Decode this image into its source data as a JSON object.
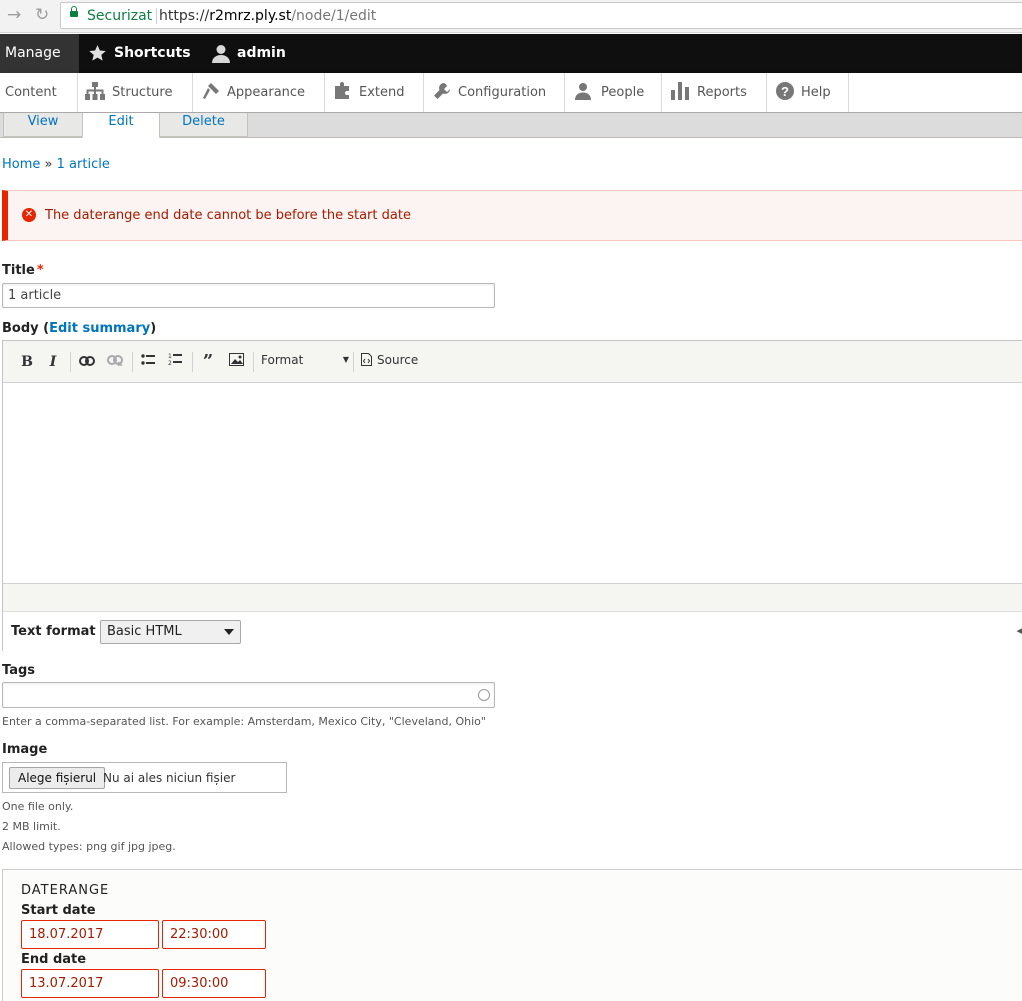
{
  "browser": {
    "secure_label": "Securizat",
    "url_scheme": "https://",
    "url_host": "r2mrz.ply.st",
    "url_path": "/node/1/edit"
  },
  "toolbar": {
    "manage": "Manage",
    "shortcuts": "Shortcuts",
    "user": "admin"
  },
  "tray": {
    "items": [
      "Content",
      "Structure",
      "Appearance",
      "Extend",
      "Configuration",
      "People",
      "Reports",
      "Help"
    ]
  },
  "tabs": [
    "View",
    "Edit",
    "Delete"
  ],
  "breadcrumb": {
    "home": "Home",
    "sep": "»",
    "current": "1 article"
  },
  "error_message": "The daterange end date cannot be before the start date",
  "title_field": {
    "label": "Title",
    "required_mark": "*",
    "value": "1 article"
  },
  "body_field": {
    "label_prefix": "Body (",
    "edit_summary": "Edit summary",
    "label_suffix": ")",
    "format_dropdown": "Format",
    "source_label": "Source",
    "text_format_label": "Text format",
    "text_format_value": "Basic HTML"
  },
  "tags_field": {
    "label": "Tags",
    "value": "",
    "description": "Enter a comma-separated list. For example: Amsterdam, Mexico City, \"Cleveland, Ohio\""
  },
  "image_field": {
    "label": "Image",
    "button": "Alege fișierul",
    "status": "Nu ai ales niciun fișier",
    "help": [
      "One file only.",
      "2 MB limit.",
      "Allowed types: png gif jpg jpeg."
    ]
  },
  "daterange": {
    "legend": "DATERANGE",
    "start_label": "Start date",
    "start_date": "18.07.2017",
    "start_time": "22:30:00",
    "end_label": "End date",
    "end_date": "13.07.2017",
    "end_time": "09:30:00"
  },
  "colors": {
    "link": "#0074bd",
    "error": "#e62600",
    "toolbar": "#0f0f0f"
  }
}
